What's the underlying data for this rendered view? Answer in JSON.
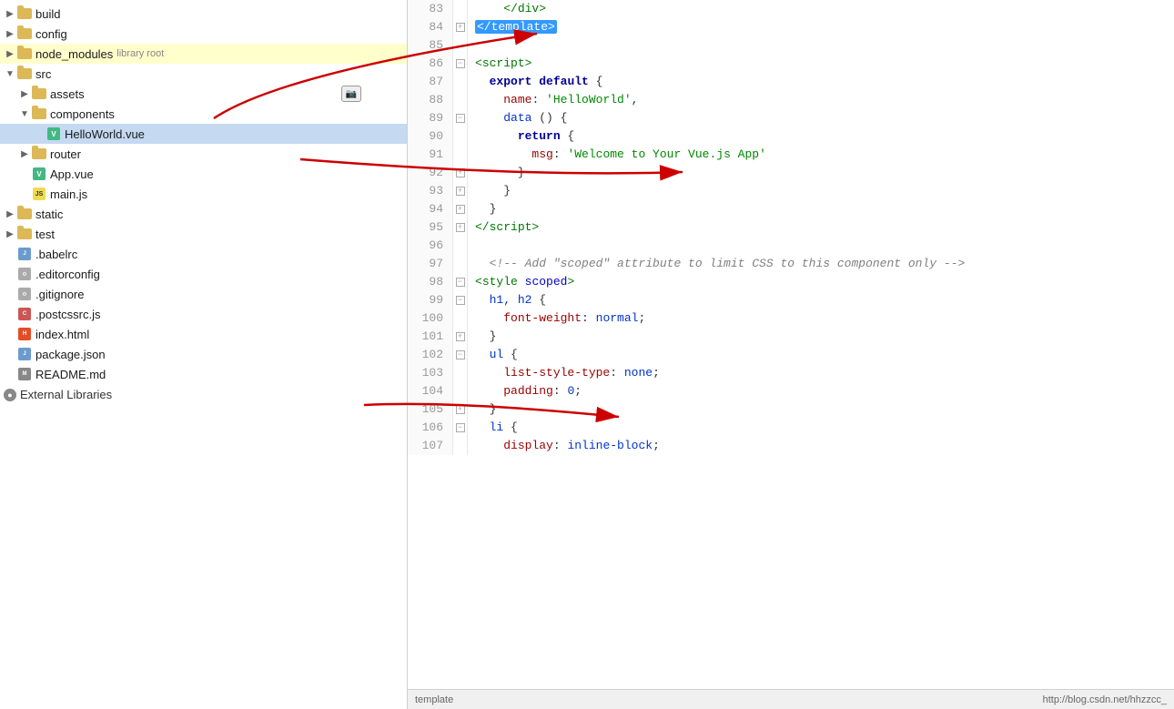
{
  "sidebar": {
    "items": [
      {
        "id": "build",
        "label": "build",
        "type": "folder",
        "indent": 0,
        "state": "closed"
      },
      {
        "id": "config",
        "label": "config",
        "type": "folder",
        "indent": 0,
        "state": "closed"
      },
      {
        "id": "node_modules",
        "label": "node_modules",
        "type": "folder",
        "indent": 0,
        "state": "closed",
        "badge": "library root"
      },
      {
        "id": "src",
        "label": "src",
        "type": "folder",
        "indent": 0,
        "state": "open"
      },
      {
        "id": "assets",
        "label": "assets",
        "type": "folder",
        "indent": 1,
        "state": "closed"
      },
      {
        "id": "components",
        "label": "components",
        "type": "folder",
        "indent": 1,
        "state": "open"
      },
      {
        "id": "HelloWorld.vue",
        "label": "HelloWorld.vue",
        "type": "vue",
        "indent": 2,
        "state": "none",
        "selected": true
      },
      {
        "id": "router",
        "label": "router",
        "type": "folder",
        "indent": 1,
        "state": "closed"
      },
      {
        "id": "App.vue",
        "label": "App.vue",
        "type": "vue",
        "indent": 1,
        "state": "none"
      },
      {
        "id": "main.js",
        "label": "main.js",
        "type": "js",
        "indent": 1,
        "state": "none"
      },
      {
        "id": "static",
        "label": "static",
        "type": "folder",
        "indent": 0,
        "state": "closed"
      },
      {
        "id": "test",
        "label": "test",
        "type": "folder",
        "indent": 0,
        "state": "closed"
      },
      {
        "id": ".babelrc",
        "label": ".babelrc",
        "type": "json",
        "indent": 0,
        "state": "none"
      },
      {
        "id": ".editorconfig",
        "label": ".editorconfig",
        "type": "config",
        "indent": 0,
        "state": "none"
      },
      {
        "id": ".gitignore",
        "label": ".gitignore",
        "type": "config",
        "indent": 0,
        "state": "none"
      },
      {
        "id": ".postcssrc.js",
        "label": ".postcssrc.js",
        "type": "css",
        "indent": 0,
        "state": "none"
      },
      {
        "id": "index.html",
        "label": "index.html",
        "type": "html",
        "indent": 0,
        "state": "none"
      },
      {
        "id": "package.json",
        "label": "package.json",
        "type": "json",
        "indent": 0,
        "state": "none"
      },
      {
        "id": "README.md",
        "label": "README.md",
        "type": "md",
        "indent": 0,
        "state": "none"
      }
    ],
    "external_libraries": "External Libraries"
  },
  "editor": {
    "lines": [
      {
        "num": 83,
        "fold": false,
        "content": [
          {
            "t": "plain",
            "v": "    "
          },
          {
            "t": "angle",
            "v": "</"
          },
          {
            "t": "tag",
            "v": "div"
          },
          {
            "t": "angle",
            "v": ">"
          }
        ]
      },
      {
        "num": 84,
        "fold": true,
        "foldType": "close",
        "content": [
          {
            "t": "selected",
            "v": "</template>"
          }
        ]
      },
      {
        "num": 85,
        "fold": false,
        "content": []
      },
      {
        "num": 86,
        "fold": true,
        "foldType": "open",
        "content": [
          {
            "t": "angle",
            "v": "<"
          },
          {
            "t": "tag",
            "v": "script"
          },
          {
            "t": "angle",
            "v": ">"
          }
        ]
      },
      {
        "num": 87,
        "fold": false,
        "content": [
          {
            "t": "plain",
            "v": "  "
          },
          {
            "t": "keyword",
            "v": "export"
          },
          {
            "t": "plain",
            "v": " "
          },
          {
            "t": "keyword",
            "v": "default"
          },
          {
            "t": "plain",
            "v": " {"
          }
        ]
      },
      {
        "num": 88,
        "fold": false,
        "content": [
          {
            "t": "plain",
            "v": "    "
          },
          {
            "t": "property",
            "v": "name"
          },
          {
            "t": "plain",
            "v": ": "
          },
          {
            "t": "green",
            "v": "'HelloWorld'"
          },
          {
            "t": "plain",
            "v": ","
          }
        ]
      },
      {
        "num": 89,
        "fold": true,
        "foldType": "open",
        "content": [
          {
            "t": "plain",
            "v": "    "
          },
          {
            "t": "blue",
            "v": "data"
          },
          {
            "t": "plain",
            "v": " () {"
          }
        ]
      },
      {
        "num": 90,
        "fold": false,
        "content": [
          {
            "t": "plain",
            "v": "      "
          },
          {
            "t": "keyword",
            "v": "return"
          },
          {
            "t": "plain",
            "v": " {"
          }
        ]
      },
      {
        "num": 91,
        "fold": false,
        "content": [
          {
            "t": "plain",
            "v": "        "
          },
          {
            "t": "property",
            "v": "msg"
          },
          {
            "t": "plain",
            "v": ": "
          },
          {
            "t": "green",
            "v": "'Welcome to Your Vue.js App'"
          }
        ]
      },
      {
        "num": 92,
        "fold": true,
        "foldType": "close",
        "content": [
          {
            "t": "plain",
            "v": "      }"
          }
        ]
      },
      {
        "num": 93,
        "fold": true,
        "foldType": "close",
        "content": [
          {
            "t": "plain",
            "v": "    }"
          }
        ]
      },
      {
        "num": 94,
        "fold": true,
        "foldType": "close",
        "content": [
          {
            "t": "plain",
            "v": "  }"
          }
        ]
      },
      {
        "num": 95,
        "fold": true,
        "foldType": "close",
        "content": [
          {
            "t": "angle",
            "v": "</"
          },
          {
            "t": "tag",
            "v": "script"
          },
          {
            "t": "angle",
            "v": ">"
          }
        ]
      },
      {
        "num": 96,
        "fold": false,
        "content": []
      },
      {
        "num": 97,
        "fold": false,
        "content": [
          {
            "t": "plain",
            "v": "  "
          },
          {
            "t": "comment",
            "v": "<!-- Add \"scoped\" attribute to limit CSS to this component only -->"
          }
        ]
      },
      {
        "num": 98,
        "fold": true,
        "foldType": "open",
        "content": [
          {
            "t": "angle",
            "v": "<"
          },
          {
            "t": "tag",
            "v": "style"
          },
          {
            "t": "plain",
            "v": " "
          },
          {
            "t": "attr",
            "v": "scoped"
          },
          {
            "t": "angle",
            "v": ">"
          }
        ]
      },
      {
        "num": 99,
        "fold": true,
        "foldType": "open",
        "content": [
          {
            "t": "plain",
            "v": "  "
          },
          {
            "t": "blue",
            "v": "h1, h2"
          },
          {
            "t": "plain",
            "v": " {"
          }
        ]
      },
      {
        "num": 100,
        "fold": false,
        "content": [
          {
            "t": "plain",
            "v": "    "
          },
          {
            "t": "property",
            "v": "font-weight"
          },
          {
            "t": "plain",
            "v": ": "
          },
          {
            "t": "blue",
            "v": "normal"
          },
          {
            "t": "plain",
            "v": ";"
          }
        ]
      },
      {
        "num": 101,
        "fold": true,
        "foldType": "close",
        "content": [
          {
            "t": "plain",
            "v": "  }"
          }
        ]
      },
      {
        "num": 102,
        "fold": true,
        "foldType": "open",
        "content": [
          {
            "t": "plain",
            "v": "  "
          },
          {
            "t": "blue",
            "v": "ul"
          },
          {
            "t": "plain",
            "v": " {"
          }
        ]
      },
      {
        "num": 103,
        "fold": false,
        "content": [
          {
            "t": "plain",
            "v": "    "
          },
          {
            "t": "property",
            "v": "list-style-type"
          },
          {
            "t": "plain",
            "v": ": "
          },
          {
            "t": "blue",
            "v": "none"
          },
          {
            "t": "plain",
            "v": ";"
          }
        ]
      },
      {
        "num": 104,
        "fold": false,
        "content": [
          {
            "t": "plain",
            "v": "    "
          },
          {
            "t": "property",
            "v": "padding"
          },
          {
            "t": "plain",
            "v": ": "
          },
          {
            "t": "blue",
            "v": "0"
          },
          {
            "t": "plain",
            "v": ";"
          }
        ]
      },
      {
        "num": 105,
        "fold": true,
        "foldType": "close",
        "content": [
          {
            "t": "plain",
            "v": "  }"
          }
        ]
      },
      {
        "num": 106,
        "fold": true,
        "foldType": "open",
        "content": [
          {
            "t": "plain",
            "v": "  "
          },
          {
            "t": "blue",
            "v": "li"
          },
          {
            "t": "plain",
            "v": " {"
          }
        ]
      },
      {
        "num": 107,
        "fold": false,
        "content": [
          {
            "t": "plain",
            "v": "    "
          },
          {
            "t": "property",
            "v": "display"
          },
          {
            "t": "plain",
            "v": ": "
          },
          {
            "t": "blue",
            "v": "inline-block"
          },
          {
            "t": "plain",
            "v": ";"
          }
        ]
      }
    ],
    "status_bar": {
      "left": "template",
      "right": "http://blog.csdn.net/hhzzcc_"
    }
  }
}
